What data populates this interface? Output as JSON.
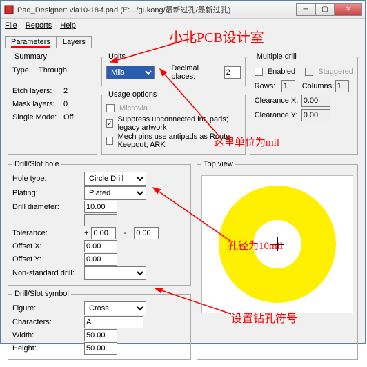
{
  "window": {
    "title": "Pad_Designer: via10-18-f.pad (E:.../gukong/最新过孔/最新过孔)"
  },
  "menu": {
    "file": "File",
    "reports": "Reports",
    "help": "Help"
  },
  "tabs": {
    "parameters": "Parameters",
    "layers": "Layers"
  },
  "summary": {
    "legend": "Summary",
    "type_label": "Type:",
    "type_value": "Through",
    "etch_label": "Etch layers:",
    "etch_value": "2",
    "mask_label": "Mask layers:",
    "mask_value": "0",
    "single_label": "Single Mode:",
    "single_value": "Off"
  },
  "units": {
    "legend": "Units",
    "select": "Mils",
    "dp_label": "Decimal places:",
    "dp_value": "2"
  },
  "usage": {
    "legend": "Usage options",
    "microvia": "Microvia",
    "suppress": "Suppress unconnected int. pads; legacy artwork",
    "mech": "Mech pins use antipads as Route Keepout; ARK"
  },
  "multi": {
    "legend": "Multiple drill",
    "enabled": "Enabled",
    "stag": "Staggered",
    "rows_label": "Rows:",
    "rows_value": "1",
    "cols_label": "Columns:",
    "cols_value": "1",
    "cx_label": "Clearance X:",
    "cx_value": "0.00",
    "cy_label": "Clearance Y:",
    "cy_value": "0.00"
  },
  "drill": {
    "legend": "Drill/Slot hole",
    "holetype_label": "Hole type:",
    "holetype_value": "Circle Drill",
    "plating_label": "Plating:",
    "plating_value": "Plated",
    "dia_label": "Drill diameter:",
    "dia_value": "10.00",
    "tol_label": "Tolerance:",
    "tol_plus_prefix": "+",
    "tol_plus": "0.00",
    "tol_dash": "-",
    "tol_minus": "0.00",
    "ox_label": "Offset X:",
    "ox_value": "0.00",
    "oy_label": "Offset Y:",
    "oy_value": "0.00",
    "nsd_label": "Non-standard drill:"
  },
  "symbol": {
    "legend": "Drill/Slot symbol",
    "figure_label": "Figure:",
    "figure_value": "Cross",
    "chars_label": "Characters:",
    "chars_value": "A",
    "width_label": "Width:",
    "width_value": "50.00",
    "height_label": "Height:",
    "height_value": "50.00"
  },
  "preview": {
    "legend": "Top view"
  },
  "anno": {
    "title": "小北PCB设计室",
    "unit": "这里单位为mil",
    "dia": "孔径为10mil",
    "sym": "设置钻孔符号"
  }
}
